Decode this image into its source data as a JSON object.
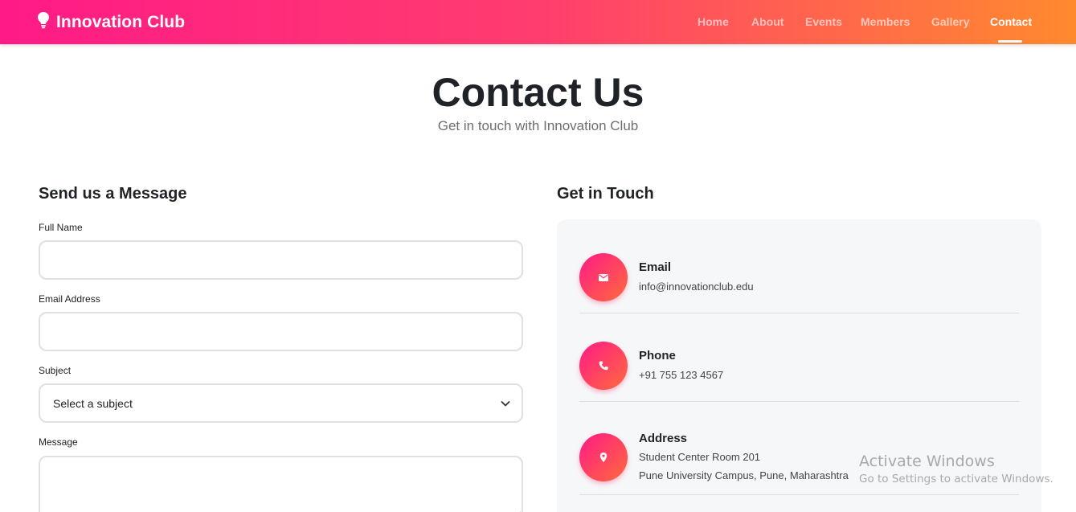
{
  "nav": {
    "brand": "Innovation Club",
    "brand_icon": "lightbulb-icon",
    "links": [
      {
        "label": "Home",
        "active": false
      },
      {
        "label": "About",
        "active": false
      },
      {
        "label": "Events",
        "active": false
      },
      {
        "label": "Members",
        "active": false
      },
      {
        "label": "Gallery",
        "active": false
      },
      {
        "label": "Contact",
        "active": true
      }
    ],
    "gradient": [
      "#ff1a87",
      "#ff3d6e",
      "#ff8a2e"
    ]
  },
  "header": {
    "title": "Contact Us",
    "subtitle": "Get in touch with Innovation Club"
  },
  "form": {
    "heading": "Send us a Message",
    "full_name_label": "Full Name",
    "full_name_value": "",
    "email_label": "Email Address",
    "email_value": "",
    "subject_label": "Subject",
    "subject_selected": "Select a subject",
    "message_label": "Message",
    "message_value": ""
  },
  "contact": {
    "heading": "Get in Touch",
    "items": [
      {
        "title": "Email",
        "lines": [
          "info@innovationclub.edu"
        ],
        "icon": "envelope-icon"
      },
      {
        "title": "Phone",
        "lines": [
          "+91 755 123 4567"
        ],
        "icon": "phone-icon"
      },
      {
        "title": "Address",
        "lines": [
          "Student Center Room 201",
          "Pune University Campus, Pune, Maharashtra"
        ],
        "icon": "map-pin-icon"
      }
    ],
    "accent": "#ff2d7a"
  },
  "watermark": {
    "title": "Activate Windows",
    "subtitle": "Go to Settings to activate Windows."
  }
}
